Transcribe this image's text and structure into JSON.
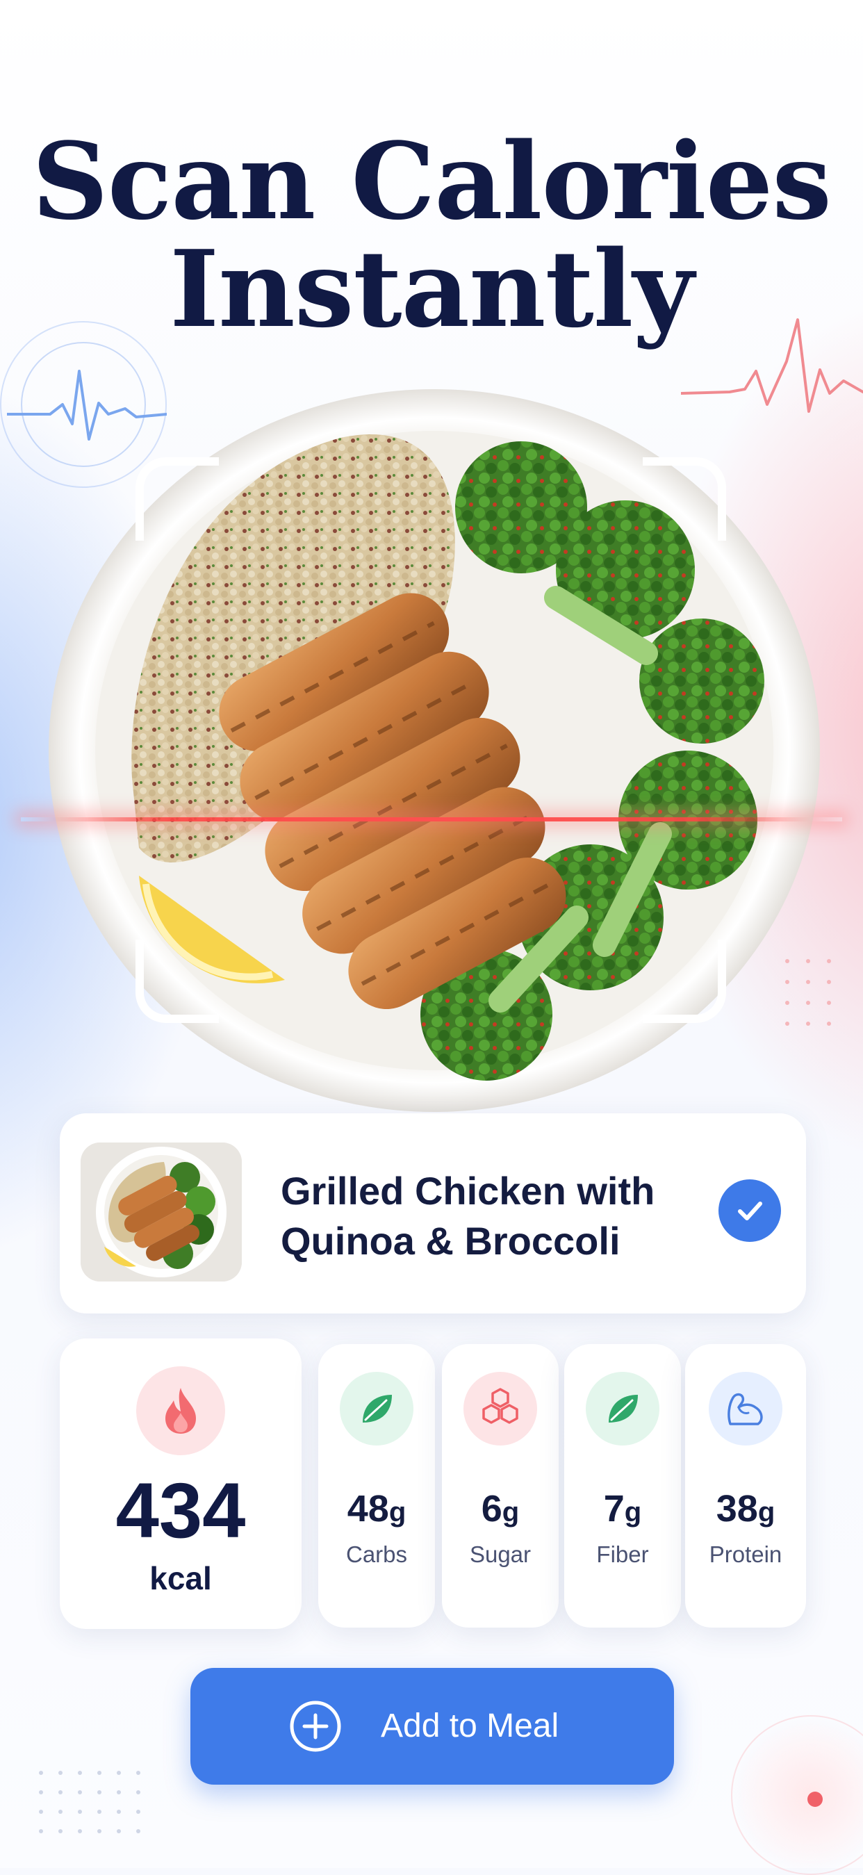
{
  "headline": {
    "line1": "Scan Calories",
    "line2": "Instantly"
  },
  "meal": {
    "name_line1": "Grilled Chicken with",
    "name_line2": "Quinoa & Broccoli",
    "icon": "check-icon",
    "verified": true
  },
  "calories": {
    "value": "434",
    "unit": "kcal",
    "icon": "flame-icon"
  },
  "nutrients": [
    {
      "value": "48",
      "unit": "g",
      "label": "Carbs",
      "icon": "leaf-icon"
    },
    {
      "value": "6",
      "unit": "g",
      "label": "Sugar",
      "icon": "hexagon-cluster-icon"
    },
    {
      "value": "7",
      "unit": "g",
      "label": "Fiber",
      "icon": "leaf-icon"
    },
    {
      "value": "38",
      "unit": "g",
      "label": "Protein",
      "icon": "flexed-arm-icon"
    }
  ],
  "cta": {
    "label": "Add to Meal",
    "icon": "plus-circle-icon"
  },
  "colors": {
    "primary": "#3f7be9",
    "heading": "#111a44",
    "scan_line": "#ff5050",
    "calorie_icon_bg": "#fde4e6",
    "fiber_icon_bg": "#e3f6ec",
    "protein_icon_bg": "#e6efff"
  }
}
